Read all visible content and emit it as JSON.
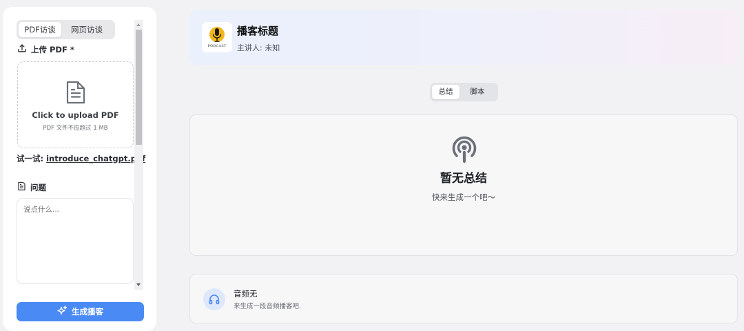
{
  "left": {
    "tabs": [
      {
        "label": "PDF访谈",
        "active": true
      },
      {
        "label": "网页访谈",
        "active": false
      }
    ],
    "upload_label": "上传 PDF *",
    "upload_title": "Click to upload PDF",
    "upload_hint": "PDF 文件不应超过 1 MB",
    "try_prefix": "试一试:",
    "try_file": "introduce_chatgpt.pdf",
    "question_label": "问题",
    "question_placeholder": "说点什么...",
    "generate_label": "生成播客"
  },
  "header": {
    "logo_text": "PODCAST",
    "title": "播客标题",
    "host": "主讲人: 未知"
  },
  "segments": [
    {
      "label": "总结",
      "active": true
    },
    {
      "label": "脚本",
      "active": false
    }
  ],
  "summary": {
    "title": "暂无总结",
    "subtitle": "快来生成一个吧～"
  },
  "audio": {
    "title": "音频无",
    "subtitle": "来生成一段音频播客吧."
  },
  "colors": {
    "primary": "#4a8af5",
    "icon_gray": "#6b7079",
    "logo_yellow": "#f2b51c"
  }
}
